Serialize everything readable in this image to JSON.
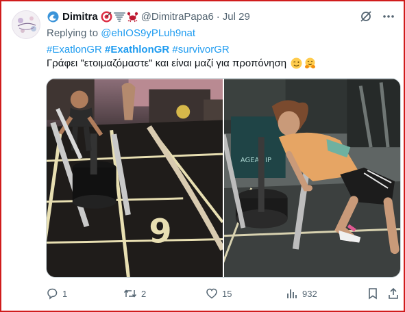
{
  "tweet": {
    "display_name": "Dimitra",
    "name_emojis": [
      "bullseye-emoji",
      "tornado-emoji",
      "crab-emoji"
    ],
    "handle": "@DimitraPapa6",
    "separator": "·",
    "date": "Jul 29",
    "replying_label": "Replying to",
    "replying_to": "@ehIOS9yPLuh9nat",
    "hashtags": [
      "#ExatlonGR",
      "#ExathlonGR",
      "#survivorGR"
    ],
    "text": "Γράφει \"ετοιμαζόμαστε\" και είναι μαζί για προπόνηση",
    "text_emojis": [
      "winking-face-emoji",
      "hugging-face-emoji"
    ],
    "media": [
      {
        "name": "photo-sled-push-man"
      },
      {
        "name": "photo-sled-push-woman"
      }
    ]
  },
  "actions": {
    "reply_count": "1",
    "retweet_count": "2",
    "like_count": "15",
    "views_count": "932"
  },
  "colors": {
    "accent": "#1d9bf0",
    "secondary_text": "#536471",
    "frame_border": "#d01c1c"
  }
}
